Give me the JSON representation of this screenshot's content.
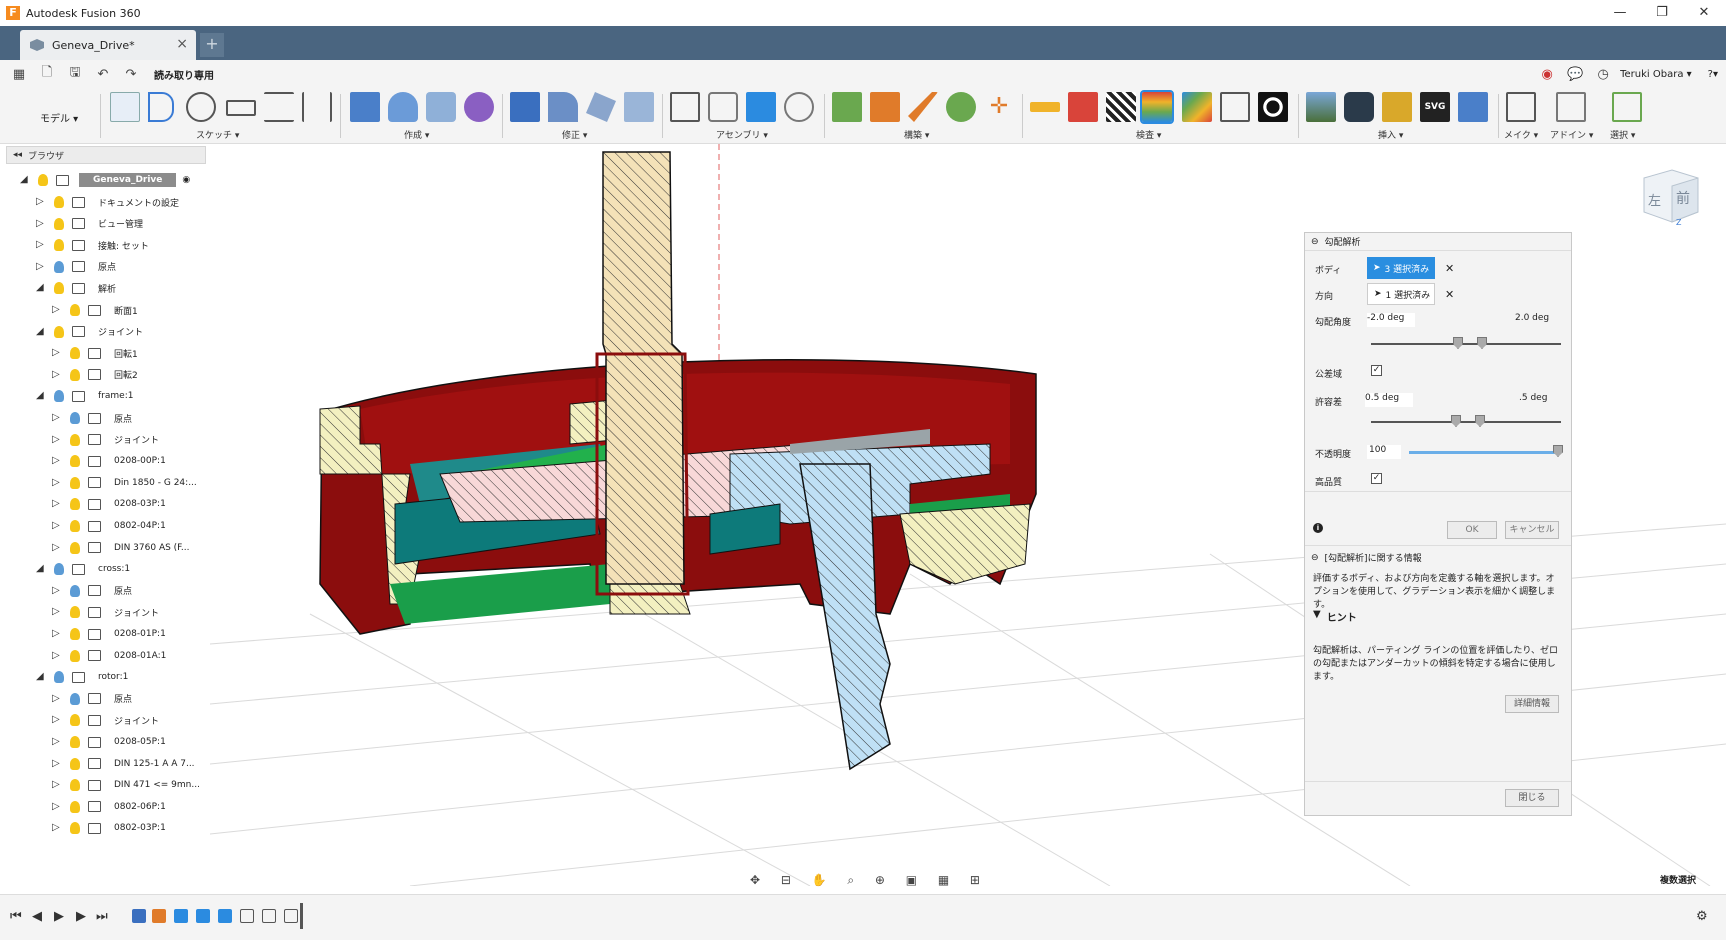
{
  "app": {
    "title": "Autodesk Fusion 360",
    "logo": "F"
  },
  "tab": {
    "label": "Geneva_Drive*",
    "close": "×",
    "new": "+"
  },
  "quick": {
    "read_only": "読み取り専用",
    "user": "Teruki Obara ▾",
    "help": "?▾"
  },
  "ribbon": {
    "mode": "モデル ▾",
    "groups": [
      "スケッチ ▾",
      "作成 ▾",
      "修正 ▾",
      "アセンブリ ▾",
      "構築 ▾",
      "検査 ▾",
      "挿入 ▾",
      "メイク ▾",
      "アドイン ▾",
      "選択 ▾"
    ]
  },
  "browser": {
    "header": "ブラウザ",
    "root": "Geneva_Drive",
    "items": [
      {
        "label": "ドキュメントの設定",
        "level": 1,
        "icon": "gear-icon"
      },
      {
        "label": "ビュー管理",
        "level": 1,
        "icon": "folder-icon"
      },
      {
        "label": "接触: セット",
        "level": 1,
        "icon": "contact-icon"
      },
      {
        "label": "原点",
        "level": 1,
        "icon": "folder-icon"
      },
      {
        "label": "解析",
        "level": 1,
        "icon": "folder-icon",
        "open": true
      },
      {
        "label": "断面1",
        "level": 2,
        "icon": "section-icon"
      },
      {
        "label": "ジョイント",
        "level": 1,
        "icon": "folder-icon",
        "open": true
      },
      {
        "label": "回転1",
        "level": 2,
        "icon": "joint-icon"
      },
      {
        "label": "回転2",
        "level": 2,
        "icon": "joint-icon"
      },
      {
        "label": "frame:1",
        "level": 1,
        "icon": "component-icon",
        "open": true
      },
      {
        "label": "原点",
        "level": 2,
        "icon": "folder-icon"
      },
      {
        "label": "ジョイント",
        "level": 2,
        "icon": "folder-icon"
      },
      {
        "label": "0208-00P:1",
        "level": 2,
        "icon": "body-icon"
      },
      {
        "label": "Din 1850 - G 24:...",
        "level": 2,
        "icon": "body-icon"
      },
      {
        "label": "0208-03P:1",
        "level": 2,
        "icon": "body-icon"
      },
      {
        "label": "0802-04P:1",
        "level": 2,
        "icon": "body-icon"
      },
      {
        "label": "DIN 3760 AS (F...",
        "level": 2,
        "icon": "body-icon"
      },
      {
        "label": "cross:1",
        "level": 1,
        "icon": "component-icon",
        "open": true
      },
      {
        "label": "原点",
        "level": 2,
        "icon": "folder-icon"
      },
      {
        "label": "ジョイント",
        "level": 2,
        "icon": "folder-icon"
      },
      {
        "label": "0208-01P:1",
        "level": 2,
        "icon": "body-icon"
      },
      {
        "label": "0208-01A:1",
        "level": 2,
        "icon": "body-icon"
      },
      {
        "label": "rotor:1",
        "level": 1,
        "icon": "component-icon",
        "open": true
      },
      {
        "label": "原点",
        "level": 2,
        "icon": "folder-icon"
      },
      {
        "label": "ジョイント",
        "level": 2,
        "icon": "folder-icon"
      },
      {
        "label": "0208-05P:1",
        "level": 2,
        "icon": "body-icon"
      },
      {
        "label": "DIN 125-1 A A 7...",
        "level": 2,
        "icon": "body-icon"
      },
      {
        "label": "DIN 471 <= 9mn...",
        "level": 2,
        "icon": "body-icon"
      },
      {
        "label": "0802-06P:1",
        "level": 2,
        "icon": "body-icon"
      },
      {
        "label": "0802-03P:1",
        "level": 2,
        "icon": "body-icon"
      }
    ]
  },
  "viewcube": {
    "left": "左",
    "front": "前",
    "z": "Z"
  },
  "panel": {
    "title": "勾配解析",
    "body_label": "ボディ",
    "body_value": "3 選択済み",
    "dir_label": "方向",
    "dir_value": "1 選択済み",
    "angle_label": "勾配角度",
    "angle_min": "-2.0 deg",
    "angle_max": "2.0 deg",
    "tol_check_label": "公差域",
    "tol_label": "許容差",
    "tol_min": "0.5 deg",
    "tol_max": ".5 deg",
    "opacity_label": "不透明度",
    "opacity_value": "100",
    "quality_label": "高品質",
    "ok": "OK",
    "cancel": "キャンセル",
    "info_title": "[勾配解析]に関する情報",
    "info_text": "評価するボディ、および方向を定義する軸を選択します。オプションを使用して、グラデーション表示を細かく調整します。",
    "hint_title": "ヒント",
    "hint_text": "勾配解析は、パーティング ラインの位置を評価したり、ゼロの勾配またはアンダーカットの傾斜を特定する場合に使用します。",
    "more": "詳細情報",
    "close": "閉じる"
  },
  "status": {
    "multi_select": "複数選択"
  }
}
